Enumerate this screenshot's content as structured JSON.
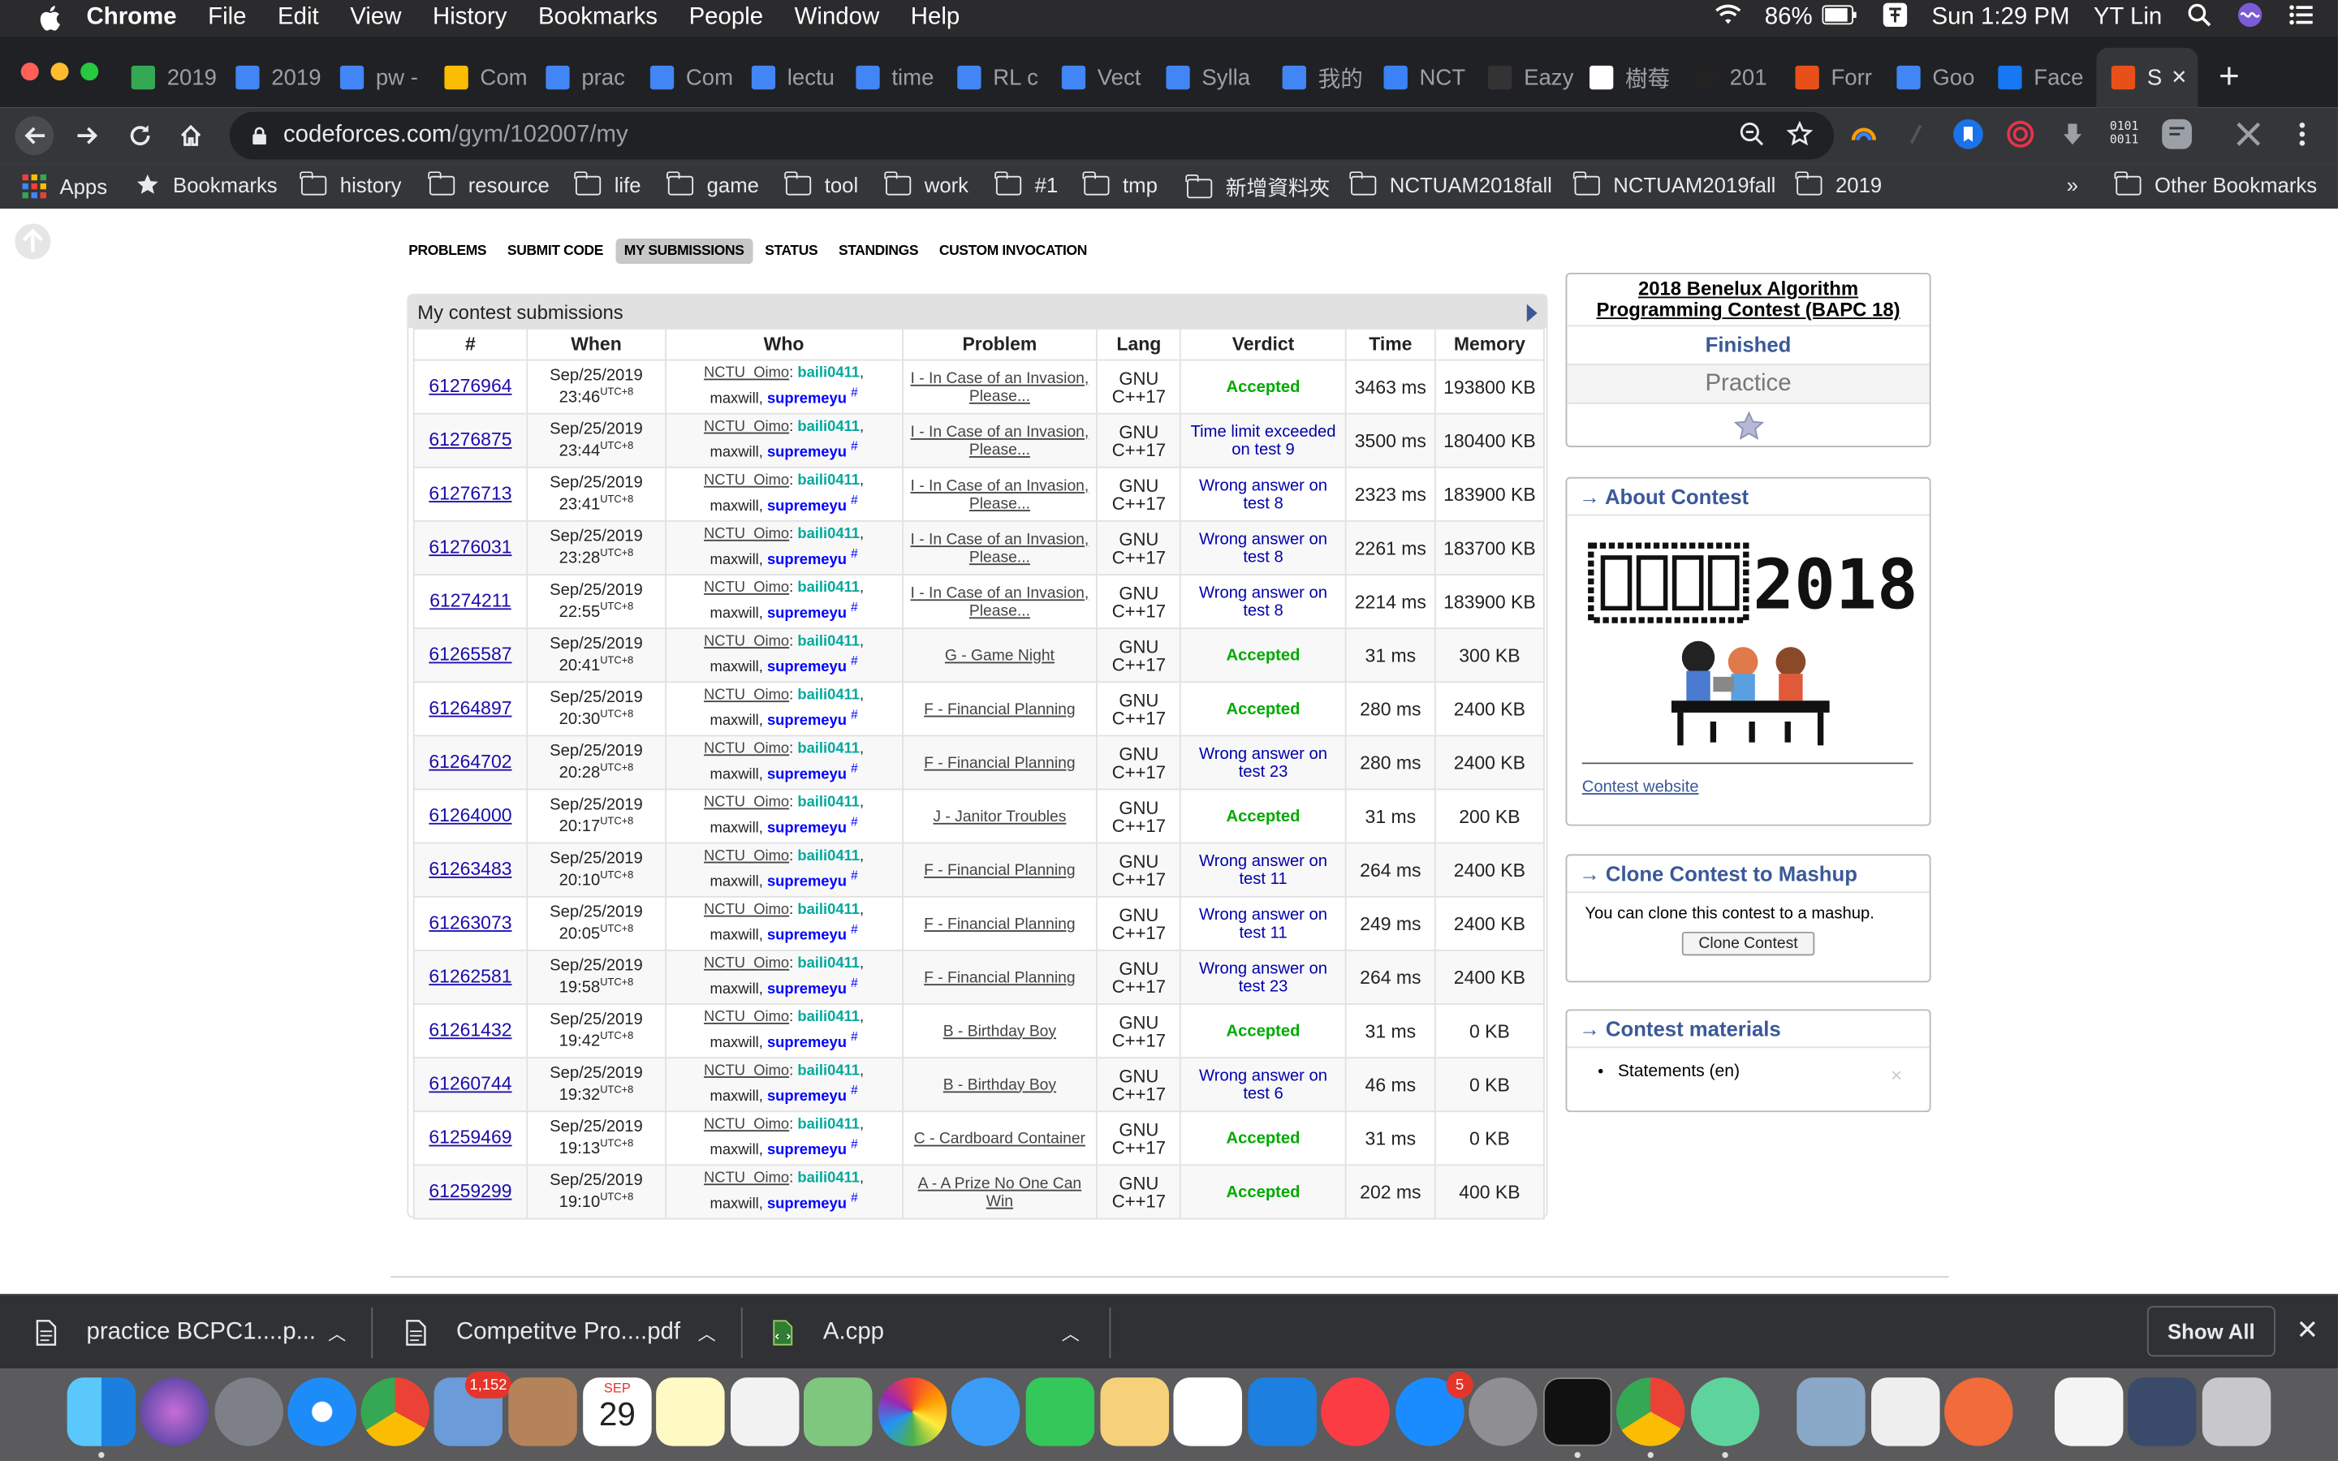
{
  "menubar": {
    "app": "Chrome",
    "items": [
      "File",
      "Edit",
      "View",
      "History",
      "Bookmarks",
      "People",
      "Window",
      "Help"
    ],
    "battery": "86%",
    "clock": "Sun 1:29 PM",
    "user": "YT Lin"
  },
  "tabs": [
    {
      "label": "2019",
      "icon": "drive-icon",
      "color": "#34a853"
    },
    {
      "label": "2019",
      "icon": "docs-icon",
      "color": "#4285f4"
    },
    {
      "label": "pw -",
      "icon": "docs-icon",
      "color": "#4285f4"
    },
    {
      "label": "Com",
      "icon": "drive-icon",
      "color": "#fbbc04"
    },
    {
      "label": "prac",
      "icon": "docs-icon",
      "color": "#4285f4"
    },
    {
      "label": "Com",
      "icon": "docs-icon",
      "color": "#4285f4"
    },
    {
      "label": "lectu",
      "icon": "docs-icon",
      "color": "#4285f4"
    },
    {
      "label": "time",
      "icon": "docs-icon",
      "color": "#4285f4"
    },
    {
      "label": "RL c",
      "icon": "docs-icon",
      "color": "#4285f4"
    },
    {
      "label": "Vect",
      "icon": "docs-icon",
      "color": "#4285f4"
    },
    {
      "label": "Sylla",
      "icon": "docs-icon",
      "color": "#4285f4"
    },
    {
      "label": "我的",
      "icon": "shield-icon",
      "color": "#4285f4"
    },
    {
      "label": "NCT",
      "icon": "bird-icon",
      "color": "#3b82f6"
    },
    {
      "label": "Eazy",
      "icon": "github-icon",
      "color": "#333333"
    },
    {
      "label": "樹莓",
      "icon": "wikipedia-icon",
      "color": "#ffffff"
    },
    {
      "label": "201",
      "icon": "file-icon",
      "color": "#222222"
    },
    {
      "label": "Forr",
      "icon": "codeforces-icon",
      "color": "#e8501a"
    },
    {
      "label": "Goo",
      "icon": "calendar-icon",
      "color": "#4285f4"
    },
    {
      "label": "Face",
      "icon": "facebook-icon",
      "color": "#1877f2"
    },
    {
      "label": "S",
      "icon": "codeforces-icon",
      "color": "#e8501a",
      "active": true
    }
  ],
  "address": {
    "host": "codeforces.com",
    "path": "/gym/102007/my"
  },
  "bookmarks": {
    "apps": "Apps",
    "bookmarks": "Bookmarks",
    "folders": [
      "history",
      "resource",
      "life",
      "game",
      "tool",
      "work",
      "#1",
      "tmp",
      "新增資料夾",
      "NCTUAM2018fall",
      "NCTUAM2019fall",
      "2019"
    ],
    "more": "»",
    "other": "Other Bookmarks"
  },
  "cf_nav": [
    "PROBLEMS",
    "SUBMIT CODE",
    "MY SUBMISSIONS",
    "STATUS",
    "STANDINGS",
    "CUSTOM INVOCATION"
  ],
  "submissions": {
    "title": "My contest submissions",
    "headers": [
      "#",
      "When",
      "Who",
      "Problem",
      "Lang",
      "Verdict",
      "Time",
      "Memory"
    ],
    "tz": "UTC+8",
    "team": "NCTU_Oimo",
    "members": [
      "baili0411",
      "maxwill",
      "supremeyu"
    ],
    "rows": [
      {
        "id": "61276964",
        "date": "Sep/25/2019",
        "time": "23:46",
        "problem": "I - In Case of an Invasion, Please...",
        "lang": "GNU C++17",
        "verdict": "Accepted",
        "acc": true,
        "runtime": "3463 ms",
        "memory": "193800 KB"
      },
      {
        "id": "61276875",
        "date": "Sep/25/2019",
        "time": "23:44",
        "problem": "I - In Case of an Invasion, Please...",
        "lang": "GNU C++17",
        "verdict": "Time limit exceeded on test 9",
        "acc": false,
        "runtime": "3500 ms",
        "memory": "180400 KB"
      },
      {
        "id": "61276713",
        "date": "Sep/25/2019",
        "time": "23:41",
        "problem": "I - In Case of an Invasion, Please...",
        "lang": "GNU C++17",
        "verdict": "Wrong answer on test 8",
        "acc": false,
        "runtime": "2323 ms",
        "memory": "183900 KB"
      },
      {
        "id": "61276031",
        "date": "Sep/25/2019",
        "time": "23:28",
        "problem": "I - In Case of an Invasion, Please...",
        "lang": "GNU C++17",
        "verdict": "Wrong answer on test 8",
        "acc": false,
        "runtime": "2261 ms",
        "memory": "183700 KB"
      },
      {
        "id": "61274211",
        "date": "Sep/25/2019",
        "time": "22:55",
        "problem": "I - In Case of an Invasion, Please...",
        "lang": "GNU C++17",
        "verdict": "Wrong answer on test 8",
        "acc": false,
        "runtime": "2214 ms",
        "memory": "183900 KB"
      },
      {
        "id": "61265587",
        "date": "Sep/25/2019",
        "time": "20:41",
        "problem": "G - Game Night",
        "lang": "GNU C++17",
        "verdict": "Accepted",
        "acc": true,
        "runtime": "31 ms",
        "memory": "300 KB"
      },
      {
        "id": "61264897",
        "date": "Sep/25/2019",
        "time": "20:30",
        "problem": "F - Financial Planning",
        "lang": "GNU C++17",
        "verdict": "Accepted",
        "acc": true,
        "runtime": "280 ms",
        "memory": "2400 KB"
      },
      {
        "id": "61264702",
        "date": "Sep/25/2019",
        "time": "20:28",
        "problem": "F - Financial Planning",
        "lang": "GNU C++17",
        "verdict": "Wrong answer on test 23",
        "acc": false,
        "runtime": "280 ms",
        "memory": "2400 KB"
      },
      {
        "id": "61264000",
        "date": "Sep/25/2019",
        "time": "20:17",
        "problem": "J - Janitor Troubles",
        "lang": "GNU C++17",
        "verdict": "Accepted",
        "acc": true,
        "runtime": "31 ms",
        "memory": "200 KB"
      },
      {
        "id": "61263483",
        "date": "Sep/25/2019",
        "time": "20:10",
        "problem": "F - Financial Planning",
        "lang": "GNU C++17",
        "verdict": "Wrong answer on test 11",
        "acc": false,
        "runtime": "264 ms",
        "memory": "2400 KB"
      },
      {
        "id": "61263073",
        "date": "Sep/25/2019",
        "time": "20:05",
        "problem": "F - Financial Planning",
        "lang": "GNU C++17",
        "verdict": "Wrong answer on test 11",
        "acc": false,
        "runtime": "249 ms",
        "memory": "2400 KB"
      },
      {
        "id": "61262581",
        "date": "Sep/25/2019",
        "time": "19:58",
        "problem": "F - Financial Planning",
        "lang": "GNU C++17",
        "verdict": "Wrong answer on test 23",
        "acc": false,
        "runtime": "264 ms",
        "memory": "2400 KB"
      },
      {
        "id": "61261432",
        "date": "Sep/25/2019",
        "time": "19:42",
        "problem": "B - Birthday Boy",
        "lang": "GNU C++17",
        "verdict": "Accepted",
        "acc": true,
        "runtime": "31 ms",
        "memory": "0 KB"
      },
      {
        "id": "61260744",
        "date": "Sep/25/2019",
        "time": "19:32",
        "problem": "B - Birthday Boy",
        "lang": "GNU C++17",
        "verdict": "Wrong answer on test 6",
        "acc": false,
        "runtime": "46 ms",
        "memory": "0 KB"
      },
      {
        "id": "61259469",
        "date": "Sep/25/2019",
        "time": "19:13",
        "problem": "C - Cardboard Container",
        "lang": "GNU C++17",
        "verdict": "Accepted",
        "acc": true,
        "runtime": "31 ms",
        "memory": "0 KB"
      },
      {
        "id": "61259299",
        "date": "Sep/25/2019",
        "time": "19:10",
        "problem": "A - A Prize No One Can Win",
        "lang": "GNU C++17",
        "verdict": "Accepted",
        "acc": true,
        "runtime": "202 ms",
        "memory": "400 KB"
      }
    ]
  },
  "sidebar": {
    "contest_name": "2018 Benelux Algorithm Programming Contest (BAPC 18)",
    "phase": "Finished",
    "mode": "Practice",
    "about_title": "→ About Contest",
    "logo_year": "2018",
    "contest_website": "Contest website",
    "clone_title": "→ Clone Contest to Mashup",
    "clone_text": "You can clone this contest to a mashup.",
    "clone_button": "Clone Contest",
    "materials_title": "→ Contest materials",
    "materials": [
      "Statements (en)"
    ]
  },
  "downloads": {
    "items": [
      "practice BCPC1....p...",
      "Competitve Pro....pdf",
      "A.cpp"
    ],
    "show_all": "Show All"
  },
  "dock": {
    "mail_badge": "1,152",
    "calendar_month": "SEP",
    "calendar_day": "29",
    "appstore_badge": "5"
  }
}
